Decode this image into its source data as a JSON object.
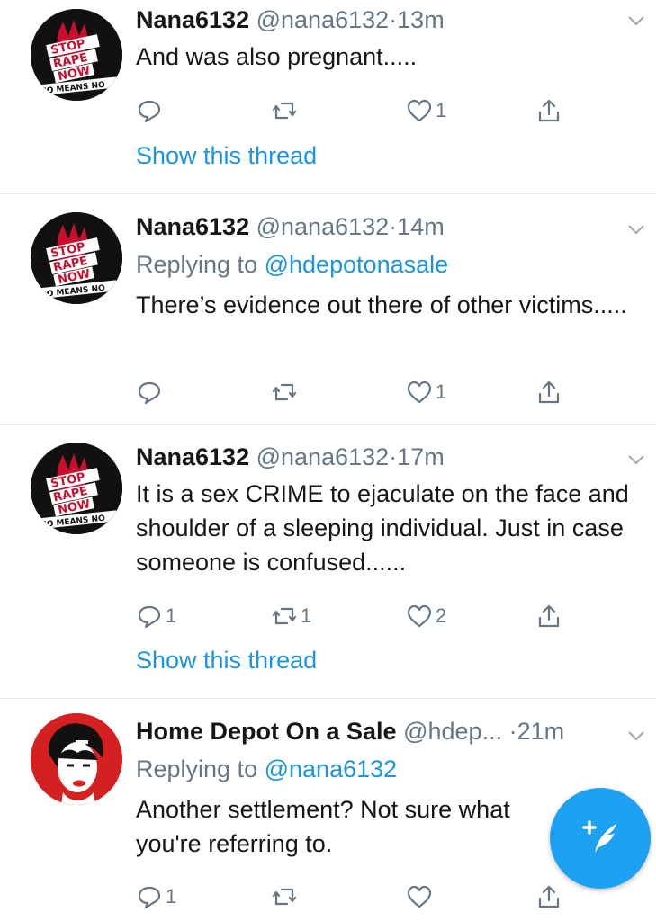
{
  "colors": {
    "accent": "#1da1f2",
    "link": "#1b95e0",
    "muted": "#657786",
    "divider": "#e6ecf0"
  },
  "avatar_logo_text": {
    "line1": "STOP",
    "line2": "RAPE",
    "line3": "NOW",
    "bottom": "NO MEANS NO"
  },
  "tweets": [
    {
      "name": "Nana6132",
      "handle": "@nana6132",
      "dot": "·",
      "time": "13m",
      "replying_label": "",
      "replying_to": "",
      "text": "And was also pregnant.....",
      "reply_count": "",
      "retweet_count": "",
      "like_count": "1",
      "show_thread": "Show this thread"
    },
    {
      "name": "Nana6132",
      "handle": "@nana6132",
      "dot": "·",
      "time": "14m",
      "replying_label": "Replying to",
      "replying_to": "@hdepotonasale",
      "text": "There’s evidence out there of other victims.....",
      "reply_count": "",
      "retweet_count": "",
      "like_count": "1",
      "show_thread": ""
    },
    {
      "name": "Nana6132",
      "handle": "@nana6132",
      "dot": "·",
      "time": "17m",
      "replying_label": "",
      "replying_to": "",
      "text": "It is a sex CRIME to ejaculate on the face and shoulder of a sleeping individual. Just in case someone is confused......",
      "reply_count": "1",
      "retweet_count": "1",
      "like_count": "2",
      "show_thread": "Show this thread"
    },
    {
      "name": "Home Depot On a Sale",
      "handle": "@hdep...",
      "dot": "·",
      "time": "21m",
      "replying_label": "Replying to",
      "replying_to": "@nana6132",
      "text": "Another settlement? Not sure what you're referring to.",
      "reply_count": "1",
      "retweet_count": "",
      "like_count": "",
      "show_thread": ""
    }
  ],
  "fab": {
    "icon": "compose-tweet-icon"
  }
}
